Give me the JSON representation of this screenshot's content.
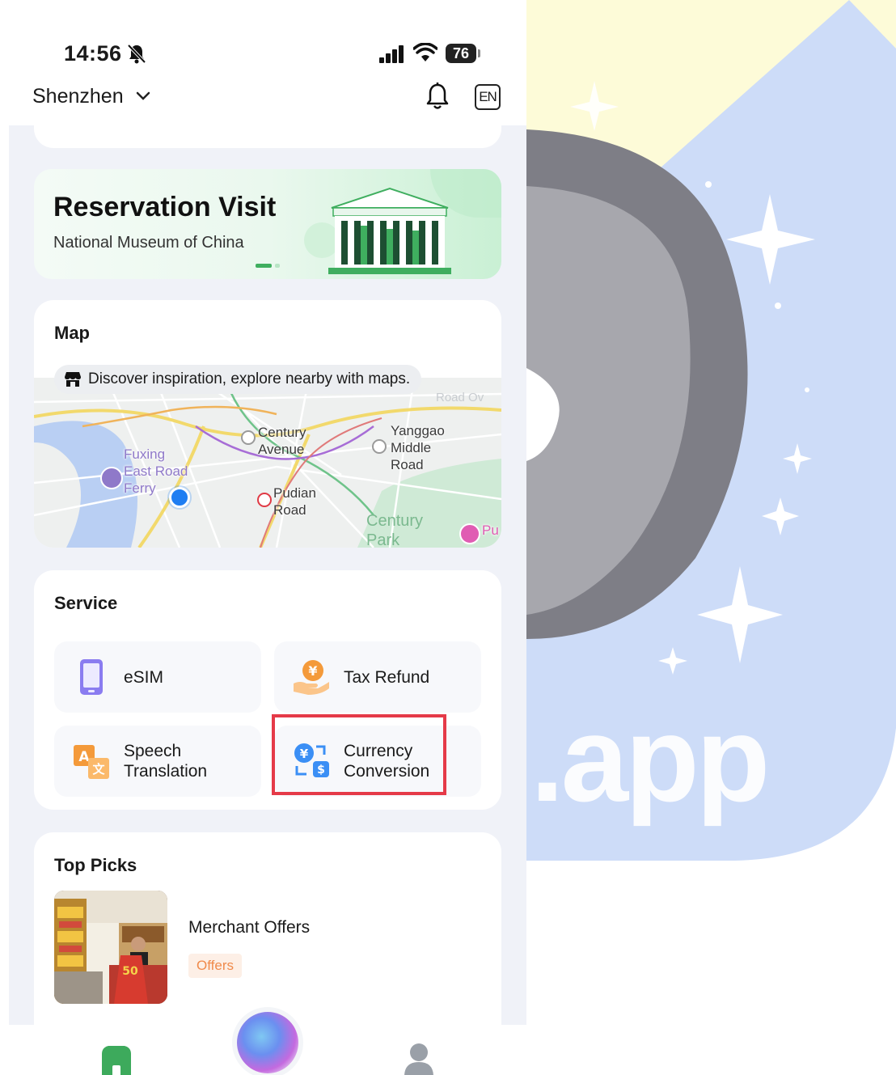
{
  "status_bar": {
    "time": "14:56",
    "battery": "76"
  },
  "header": {
    "city": "Shenzhen",
    "language": "EN"
  },
  "banner": {
    "title": "Reservation Visit",
    "subtitle": "National Museum of China"
  },
  "map": {
    "title": "Map",
    "hint": "Discover inspiration, explore nearby with maps.",
    "places": {
      "century_avenue": "Century\nAvenue",
      "yanggao": "Yanggao\nMiddle\nRoad",
      "fuxing": "Fuxing\nEast Road\nFerry",
      "pudian": "Pudian\nRoad",
      "century_park": "Century\nPark",
      "faint_road": "Road Ov",
      "faint_pu": "Pu"
    }
  },
  "service": {
    "title": "Service",
    "items": [
      {
        "label": "eSIM",
        "icon": "phone-icon"
      },
      {
        "label": "Tax Refund",
        "icon": "hand-coin-icon"
      },
      {
        "label": "Speech\nTranslation",
        "icon": "translate-icon"
      },
      {
        "label": "Currency\nConversion",
        "icon": "currency-exchange-icon"
      }
    ]
  },
  "top_picks": {
    "title": "Top Picks",
    "items": [
      {
        "title": "Merchant Offers",
        "tag": "Offers"
      }
    ]
  },
  "background": {
    "watermark_text": ".app"
  },
  "colors": {
    "highlight": "#e53a48",
    "location_dot": "#1f7ef2",
    "offers_tag": "#f08a4b",
    "home_tab": "#3daa5c"
  }
}
